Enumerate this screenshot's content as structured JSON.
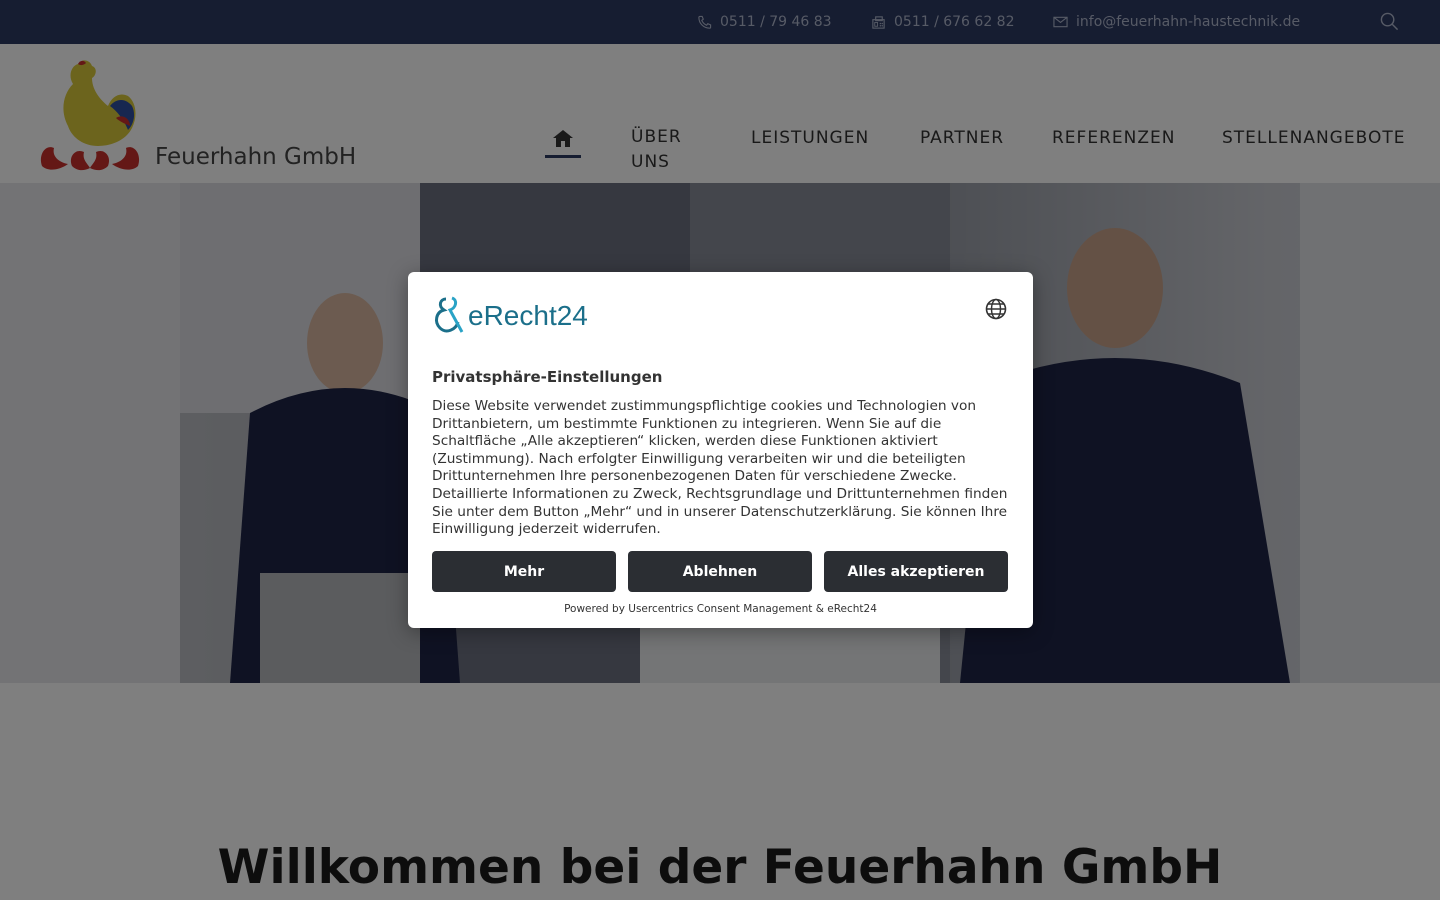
{
  "topbar": {
    "phone": "0511 / 79 46 83",
    "fax": "0511 / 676 62 82",
    "email": "info@feuerhahn-haustechnik.de"
  },
  "header": {
    "brand": "Feuerhahn GmbH"
  },
  "nav": {
    "ueber_uns_1": "ÜBER",
    "ueber_uns_2": "UNS",
    "leistungen": "LEISTUNGEN",
    "partner": "PARTNER",
    "referenzen": "REFERENZEN",
    "stellenangebote": "STELLENANGEBOTE"
  },
  "main": {
    "welcome": "Willkommen bei der Feuerhahn GmbH"
  },
  "dialog": {
    "logo_text": "eRecht24",
    "title": "Privatsphäre-Einstellungen",
    "body": "Diese Website verwendet zustimmungspflichtige cookies und Technologien von Drittanbietern, um bestimmte Funktionen zu integrieren. Wenn Sie auf die Schaltfläche „Alle akzeptieren“ klicken, werden diese Funktionen aktiviert (Zustimmung). Nach erfolgter Einwilligung verarbeiten wir und die beteiligten Drittunternehmen Ihre personenbezogenen Daten für verschiedene Zwecke. Detaillierte Informationen zu Zweck, Rechtsgrundlage und Drittunternehmen finden Sie unter dem Button „Mehr“ und in unserer Datenschutzerklärung. Sie können Ihre Einwilligung jederzeit widerrufen.",
    "btn_more": "Mehr",
    "btn_decline": "Ablehnen",
    "btn_accept": "Alles akzeptieren",
    "powered": "Powered by Usercentrics Consent Management & eRecht24"
  },
  "colors": {
    "topbar": "#2d3a63",
    "button": "#2b2e33",
    "brand_accent": "#1b6f8a"
  },
  "icons": [
    "phone-icon",
    "fax-icon",
    "mail-icon",
    "search-icon",
    "home-icon",
    "globe-icon"
  ]
}
